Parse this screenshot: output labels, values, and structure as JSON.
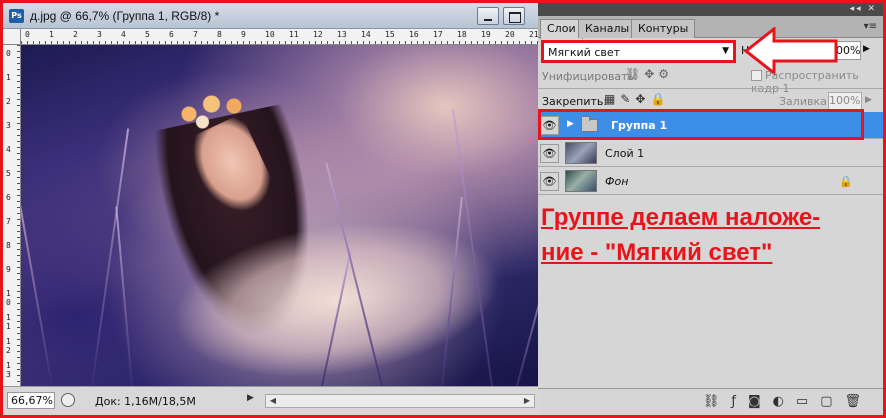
{
  "document": {
    "title": "д.jpg @ 66,7% (Группа 1, RGB/8) *",
    "app_icon": "Ps",
    "zoom": "66,67%",
    "doc_size": "Док: 1,16M/18,5M",
    "ruler_top_ticks": [
      "0",
      "1",
      "2",
      "3",
      "4",
      "5",
      "6",
      "7",
      "8",
      "9",
      "10",
      "11",
      "12",
      "13",
      "14",
      "15",
      "16",
      "17",
      "18",
      "19",
      "20",
      "21"
    ],
    "ruler_left_ticks": [
      "0",
      "1",
      "2",
      "3",
      "4",
      "5",
      "6",
      "7",
      "8",
      "9",
      "10",
      "11",
      "12",
      "13"
    ]
  },
  "panel": {
    "tabs": [
      {
        "label": "Слои",
        "active": true
      },
      {
        "label": "Каналы",
        "active": false
      },
      {
        "label": "Контуры",
        "active": false
      }
    ],
    "blend_mode": "Мягкий свет",
    "opacity_label": "Не",
    "opacity_value": "00%",
    "unify_label": "Унифицировать:",
    "propagate_label": "Распространить кадр 1",
    "lock_label": "Закрепить:",
    "fill_label": "Заливка:",
    "fill_value": "100%",
    "layers": [
      {
        "name": "Группа 1",
        "type": "group",
        "selected": true
      },
      {
        "name": "Слой 1",
        "type": "layer",
        "selected": false
      },
      {
        "name": "Фон",
        "type": "background",
        "selected": false,
        "locked": true
      }
    ]
  },
  "annotation": {
    "line1": "Группе делаем наложе-",
    "line2": "ние - \"Мягкий свет\""
  },
  "colors": {
    "highlight_red": "#e8141c",
    "selection_blue": "#3d8ee6"
  }
}
